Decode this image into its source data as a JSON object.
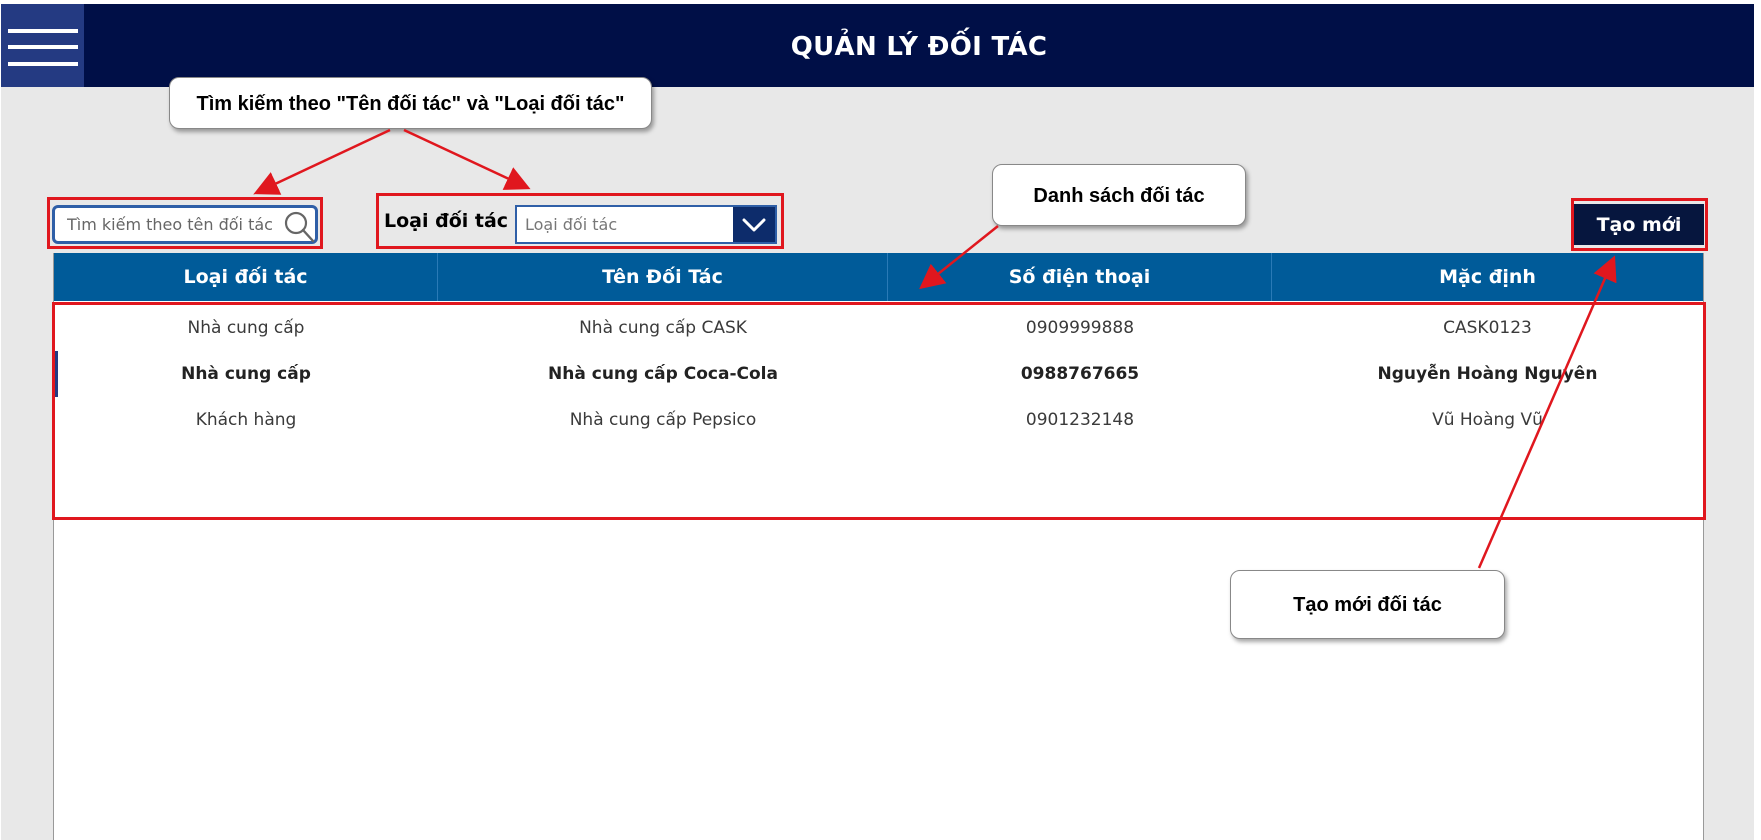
{
  "header": {
    "title": "QUẢN LÝ ĐỐI TÁC",
    "menu_icon": "hamburger-icon"
  },
  "toolbar": {
    "search_placeholder": "Tìm kiếm theo tên đối tác",
    "search_icon": "search-icon",
    "filter_label": "Loại đối tác",
    "filter_placeholder": "Loại đối tác",
    "filter_icon": "chevron-down-icon",
    "new_button": "Tạo mới"
  },
  "table": {
    "columns": [
      "Loại đối tác",
      "Tên Đối Tác",
      "Số điện thoại",
      "Mặc định"
    ],
    "rows": [
      [
        "Nhà cung cấp",
        "Nhà cung cấp CASK",
        "0909999888",
        "CASK0123"
      ],
      [
        "Nhà cung cấp",
        "Nhà cung cấp Coca-Cola",
        "0988767665",
        "Nguyễn Hoàng Nguyên"
      ],
      [
        "Khách hàng",
        "Nhà cung cấp Pepsico",
        "0901232148",
        "Vũ Hoàng Vũ"
      ]
    ],
    "selected_row": 1
  },
  "annotations": {
    "search_callout": "Tìm kiếm theo \"Tên đối tác\" và \"Loại đối tác\"",
    "list_callout": "Danh sách đối tác",
    "new_callout": "Tạo mới đối tác"
  },
  "colors": {
    "header_bg": "#000f47",
    "menu_bg": "#243a82",
    "grid_header_bg": "#005b99",
    "button_bg": "#06163e",
    "highlight": "#e0171e"
  }
}
